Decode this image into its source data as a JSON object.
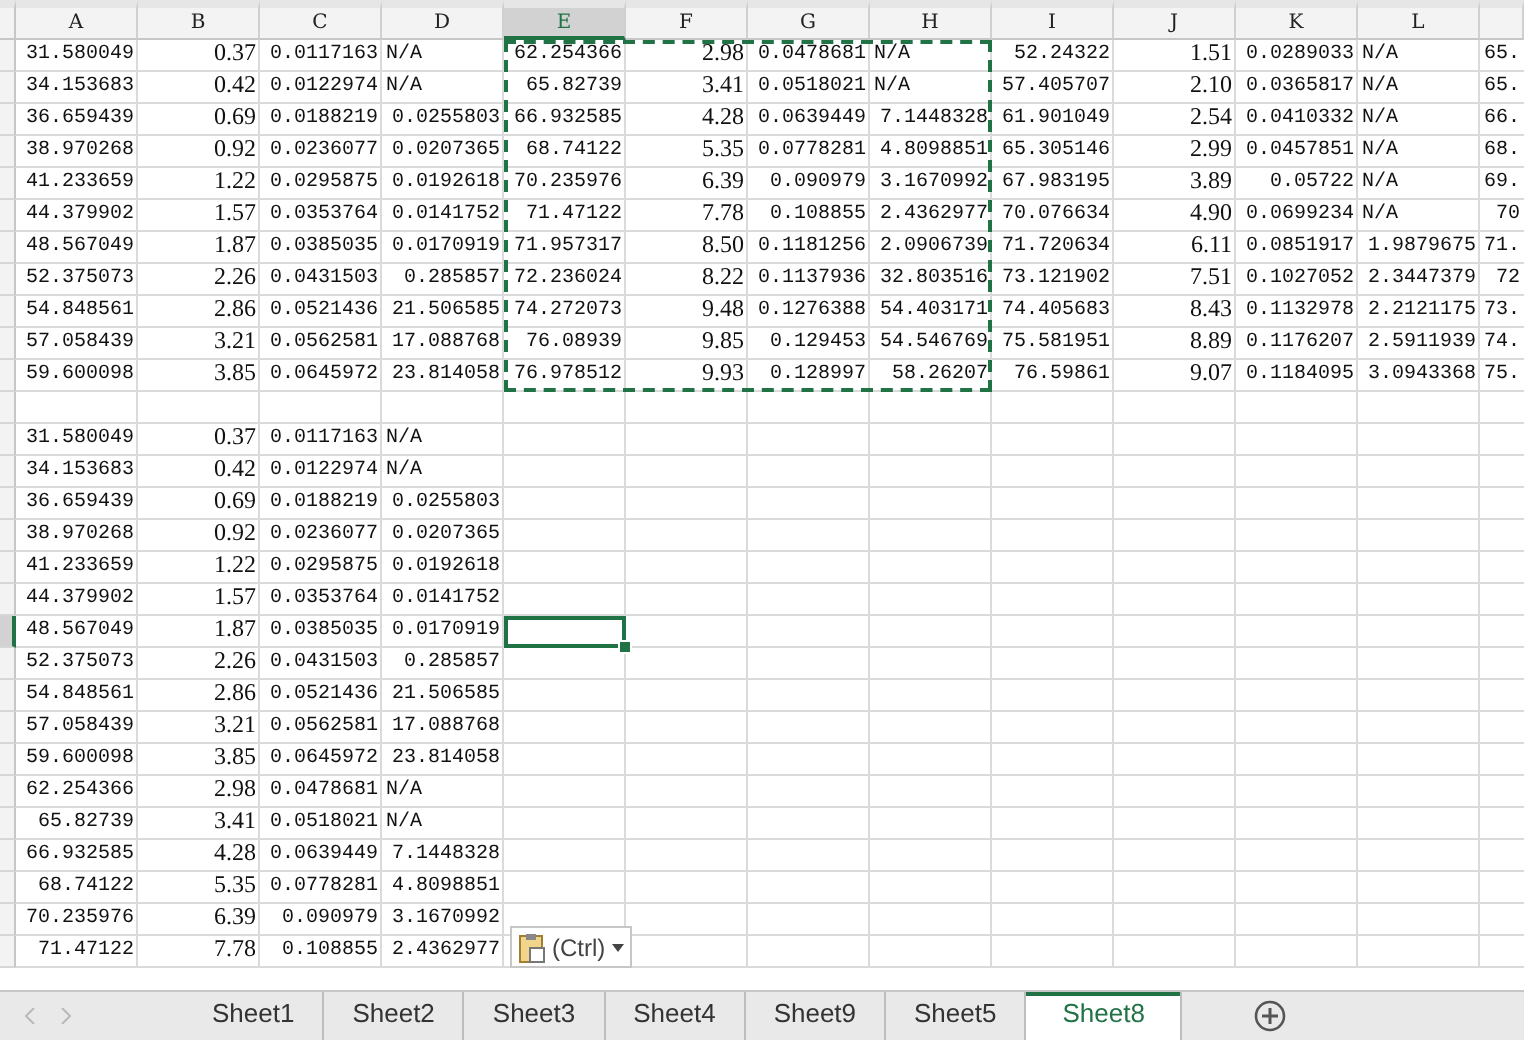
{
  "columns": [
    {
      "label": "A",
      "kind": "general",
      "selected": false
    },
    {
      "label": "B",
      "kind": "decimal",
      "selected": false
    },
    {
      "label": "C",
      "kind": "general",
      "selected": false
    },
    {
      "label": "D",
      "kind": "general",
      "selected": false
    },
    {
      "label": "E",
      "kind": "general",
      "selected": true
    },
    {
      "label": "F",
      "kind": "decimal",
      "selected": false
    },
    {
      "label": "G",
      "kind": "general",
      "selected": false
    },
    {
      "label": "H",
      "kind": "general",
      "selected": false
    },
    {
      "label": "I",
      "kind": "general",
      "selected": false
    },
    {
      "label": "J",
      "kind": "decimal",
      "selected": false
    },
    {
      "label": "K",
      "kind": "general",
      "selected": false
    },
    {
      "label": "L",
      "kind": "general",
      "selected": false
    },
    {
      "kind": "general",
      "selected": false
    }
  ],
  "rows": [
    {
      "selected": false,
      "cells": [
        "31.580049",
        "0.37",
        "0.0117163",
        "N/A",
        "62.254366",
        "2.98",
        "0.0478681",
        "N/A",
        "52.24322",
        "1.51",
        "0.0289033",
        "N/A",
        "65."
      ]
    },
    {
      "selected": false,
      "cells": [
        "34.153683",
        "0.42",
        "0.0122974",
        "N/A",
        "65.82739",
        "3.41",
        "0.0518021",
        "N/A",
        "57.405707",
        "2.10",
        "0.0365817",
        "N/A",
        "65."
      ]
    },
    {
      "selected": false,
      "cells": [
        "36.659439",
        "0.69",
        "0.0188219",
        "0.0255803",
        "66.932585",
        "4.28",
        "0.0639449",
        "7.1448328",
        "61.901049",
        "2.54",
        "0.0410332",
        "N/A",
        "66."
      ]
    },
    {
      "selected": false,
      "cells": [
        "38.970268",
        "0.92",
        "0.0236077",
        "0.0207365",
        "68.74122",
        "5.35",
        "0.0778281",
        "4.8098851",
        "65.305146",
        "2.99",
        "0.0457851",
        "N/A",
        "68."
      ]
    },
    {
      "selected": false,
      "cells": [
        "41.233659",
        "1.22",
        "0.0295875",
        "0.0192618",
        "70.235976",
        "6.39",
        "0.090979",
        "3.1670992",
        "67.983195",
        "3.89",
        "0.05722",
        "N/A",
        "69."
      ]
    },
    {
      "selected": false,
      "cells": [
        "44.379902",
        "1.57",
        "0.0353764",
        "0.0141752",
        "71.47122",
        "7.78",
        "0.108855",
        "2.4362977",
        "70.076634",
        "4.90",
        "0.0699234",
        "N/A",
        "70"
      ]
    },
    {
      "selected": false,
      "cells": [
        "48.567049",
        "1.87",
        "0.0385035",
        "0.0170919",
        "71.957317",
        "8.50",
        "0.1181256",
        "2.0906739",
        "71.720634",
        "6.11",
        "0.0851917",
        "1.9879675",
        "71."
      ]
    },
    {
      "selected": false,
      "cells": [
        "52.375073",
        "2.26",
        "0.0431503",
        "0.285857",
        "72.236024",
        "8.22",
        "0.1137936",
        "32.803516",
        "73.121902",
        "7.51",
        "0.1027052",
        "2.3447379",
        "72"
      ]
    },
    {
      "selected": false,
      "cells": [
        "54.848561",
        "2.86",
        "0.0521436",
        "21.506585",
        "74.272073",
        "9.48",
        "0.1276388",
        "54.403171",
        "74.405683",
        "8.43",
        "0.1132978",
        "2.2121175",
        "73."
      ]
    },
    {
      "selected": false,
      "cells": [
        "57.058439",
        "3.21",
        "0.0562581",
        "17.088768",
        "76.08939",
        "9.85",
        "0.129453",
        "54.546769",
        "75.581951",
        "8.89",
        "0.1176207",
        "2.5911939",
        "74."
      ]
    },
    {
      "selected": false,
      "cells": [
        "59.600098",
        "3.85",
        "0.0645972",
        "23.814058",
        "76.978512",
        "9.93",
        "0.128997",
        "58.26207",
        "76.59861",
        "9.07",
        "0.1184095",
        "3.0943368",
        "75."
      ]
    },
    {
      "selected": false,
      "cells": []
    },
    {
      "selected": false,
      "cells": [
        "31.580049",
        "0.37",
        "0.0117163",
        "N/A"
      ]
    },
    {
      "selected": false,
      "cells": [
        "34.153683",
        "0.42",
        "0.0122974",
        "N/A"
      ]
    },
    {
      "selected": false,
      "cells": [
        "36.659439",
        "0.69",
        "0.0188219",
        "0.0255803"
      ]
    },
    {
      "selected": false,
      "cells": [
        "38.970268",
        "0.92",
        "0.0236077",
        "0.0207365"
      ]
    },
    {
      "selected": false,
      "cells": [
        "41.233659",
        "1.22",
        "0.0295875",
        "0.0192618"
      ]
    },
    {
      "selected": false,
      "cells": [
        "44.379902",
        "1.57",
        "0.0353764",
        "0.0141752"
      ]
    },
    {
      "selected": true,
      "cells": [
        "48.567049",
        "1.87",
        "0.0385035",
        "0.0170919"
      ]
    },
    {
      "selected": false,
      "cells": [
        "52.375073",
        "2.26",
        "0.0431503",
        "0.285857"
      ]
    },
    {
      "selected": false,
      "cells": [
        "54.848561",
        "2.86",
        "0.0521436",
        "21.506585"
      ]
    },
    {
      "selected": false,
      "cells": [
        "57.058439",
        "3.21",
        "0.0562581",
        "17.088768"
      ]
    },
    {
      "selected": false,
      "cells": [
        "59.600098",
        "3.85",
        "0.0645972",
        "23.814058"
      ]
    },
    {
      "selected": false,
      "cells": [
        "62.254366",
        "2.98",
        "0.0478681",
        "N/A"
      ]
    },
    {
      "selected": false,
      "cells": [
        "65.82739",
        "3.41",
        "0.0518021",
        "N/A"
      ]
    },
    {
      "selected": false,
      "cells": [
        "66.932585",
        "4.28",
        "0.0639449",
        "7.1448328"
      ]
    },
    {
      "selected": false,
      "cells": [
        "68.74122",
        "5.35",
        "0.0778281",
        "4.8098851"
      ]
    },
    {
      "selected": false,
      "cells": [
        "70.235976",
        "6.39",
        "0.090979",
        "3.1670992"
      ]
    },
    {
      "selected": false,
      "cells": [
        "71.47122",
        "7.78",
        "0.108855",
        "2.4362977"
      ]
    }
  ],
  "paste_options": {
    "label": "(Ctrl)"
  },
  "sheet_tabs": [
    {
      "label": "Sheet1",
      "selected": false
    },
    {
      "label": "Sheet2",
      "selected": false
    },
    {
      "label": "Sheet3",
      "selected": false
    },
    {
      "label": "Sheet4",
      "selected": false
    },
    {
      "label": "Sheet9",
      "selected": false
    },
    {
      "label": "Sheet5",
      "selected": false
    },
    {
      "label": "Sheet8",
      "selected": true
    }
  ]
}
